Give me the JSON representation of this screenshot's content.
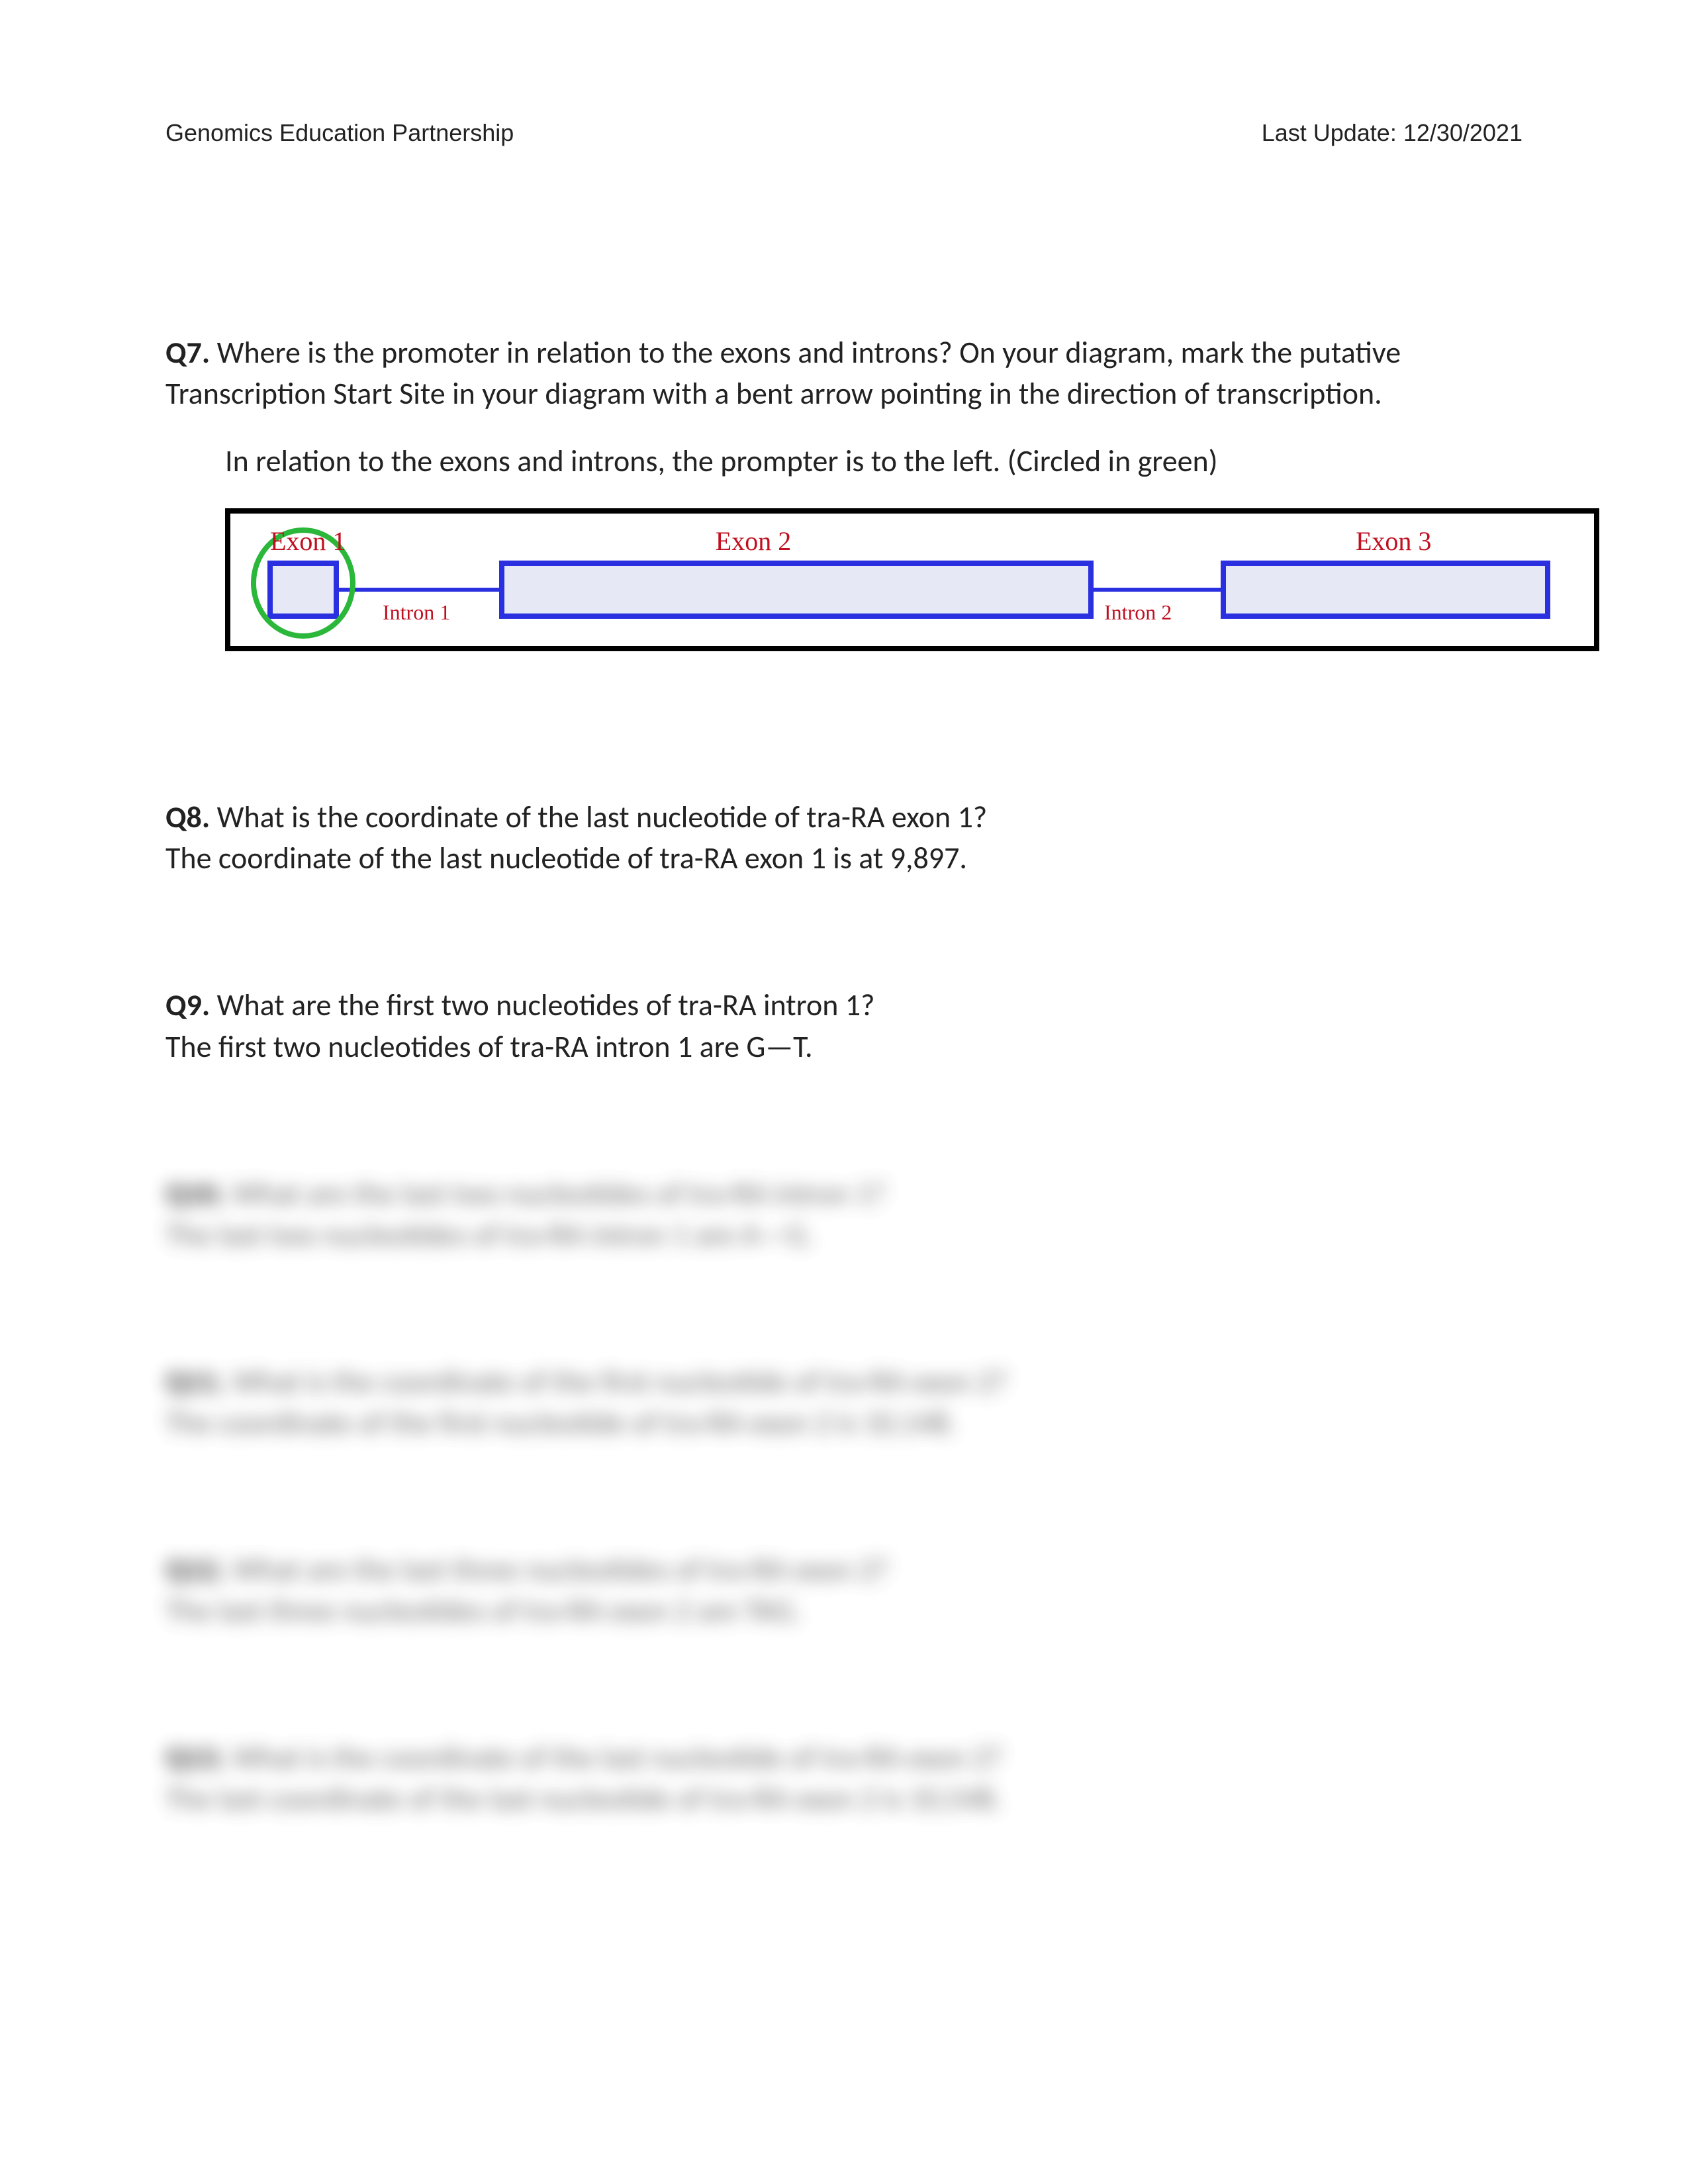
{
  "header": {
    "left": "Genomics Education Partnership",
    "right": "Last Update: 12/30/2021"
  },
  "q7": {
    "label": "Q7.",
    "question": "Where is the promoter in relation to the exons and introns? On your diagram, mark the putative Transcription Start Site in your diagram with a bent arrow pointing in the direction of transcription.",
    "answer": "In relation to the exons and introns, the prompter is to the left. (Circled in green)"
  },
  "diagram": {
    "exon1": "Exon 1",
    "exon2": "Exon 2",
    "exon3": "Exon 3",
    "intron1": "Intron 1",
    "intron2": "Intron 2"
  },
  "q8": {
    "label": "Q8.",
    "question": "What is the coordinate of the last nucleotide of tra-RA exon 1?",
    "answer": "The coordinate of the last nucleotide of tra-RA exon 1 is at 9,897."
  },
  "q9": {
    "label": "Q9.",
    "question": "What are the first two nucleotides of tra-RA intron 1?",
    "answer": "The first two nucleotides of tra-RA intron 1 are G—T."
  },
  "q10": {
    "label": "Q10.",
    "question": "What are the last two nucleotides of tra-RA intron 1?",
    "answer": "The last two nucleotides of tra-RA intron 1 are A—G."
  },
  "q11": {
    "label": "Q11.",
    "question": "What is the coordinate of the first nucleotide of tra-RA exon 2?",
    "answer": "The coordinate of the first nucleotide of tra-RA exon 2 is 10,148."
  },
  "q12": {
    "label": "Q12.",
    "question": "What are the last three nucleotides of tra-RA exon 2?",
    "answer": "The last three nucleotides of tra-RA exon 2 are TAG."
  },
  "q13": {
    "label": "Q13.",
    "question": "What is the coordinate of the last nucleotide of tra-RA exon 2?",
    "answer": "The last coordinate of the last nucleotide of tra-RA exon 2 is 10,548."
  }
}
